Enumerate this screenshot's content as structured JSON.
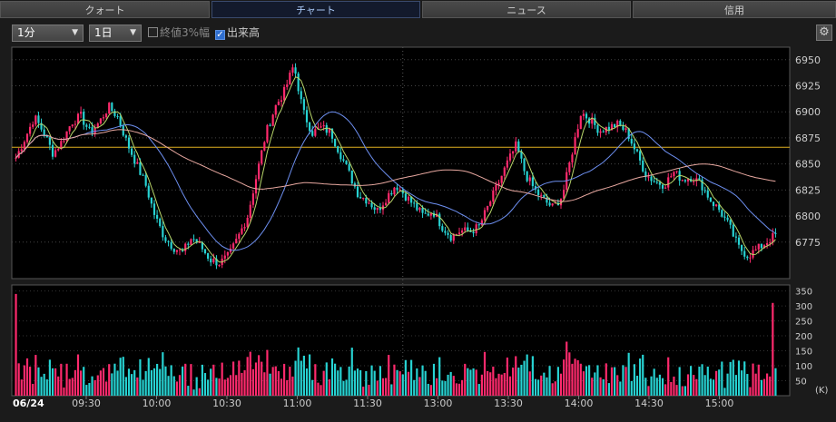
{
  "tabs": [
    {
      "label": "クォート"
    },
    {
      "label": "チャート"
    },
    {
      "label": "ニュース"
    },
    {
      "label": "信用"
    }
  ],
  "toolbar": {
    "interval": "1分",
    "period": "1日",
    "limit_label": "終値3%幅",
    "volume_label": "出来高",
    "limit_checked": false,
    "volume_checked": true
  },
  "chart_data": {
    "type": "candlestick",
    "date_label": "06/24",
    "time_ticks": [
      "09:30",
      "10:00",
      "10:30",
      "11:00",
      "11:30",
      "13:00",
      "13:30",
      "14:00",
      "14:30",
      "15:00"
    ],
    "price_ticks": [
      6950,
      6925,
      6900,
      6875,
      6850,
      6825,
      6800,
      6775
    ],
    "price_range": [
      6740,
      6962
    ],
    "reference_line": 6866,
    "volume_ticks": [
      350,
      300,
      250,
      200,
      150,
      100,
      50
    ],
    "volume_unit": "(K)",
    "volume_range": [
      0,
      370
    ],
    "path": [
      6856,
      6875,
      6895,
      6880,
      6860,
      6872,
      6890,
      6896,
      6880,
      6890,
      6905,
      6895,
      6870,
      6850,
      6830,
      6800,
      6780,
      6770,
      6765,
      6780,
      6770,
      6758,
      6755,
      6762,
      6780,
      6800,
      6840,
      6880,
      6905,
      6920,
      6945,
      6900,
      6880,
      6885,
      6880,
      6860,
      6840,
      6820,
      6815,
      6805,
      6818,
      6830,
      6820,
      6810,
      6800,
      6805,
      6790,
      6780,
      6786,
      6785,
      6790,
      6810,
      6830,
      6850,
      6868,
      6840,
      6825,
      6815,
      6808,
      6820,
      6860,
      6900,
      6892,
      6882,
      6885,
      6888,
      6880,
      6860,
      6840,
      6833,
      6830,
      6842,
      6835,
      6838,
      6830,
      6815,
      6805,
      6790,
      6770,
      6762,
      6768,
      6775,
      6782
    ],
    "colors": {
      "up": "#ff2a6d",
      "down": "#27d3d3",
      "ma_short": "#b8d66a",
      "ma_mid": "#6d8ff0",
      "ma_long": "#e8a8a0",
      "reference": "#e0b020"
    }
  }
}
